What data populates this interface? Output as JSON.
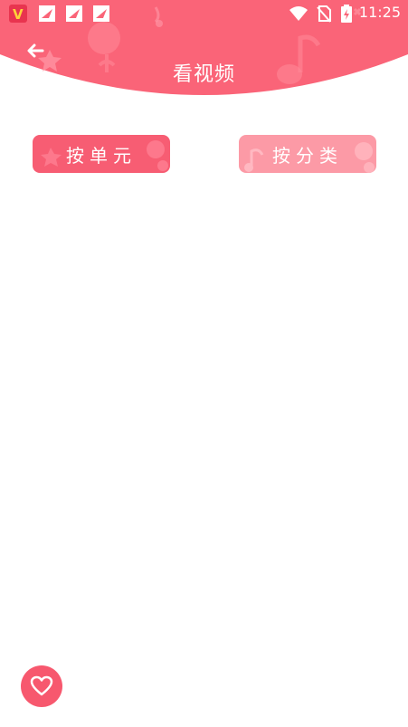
{
  "status_bar": {
    "time": "11:25",
    "notification_icons": [
      "vidmate-app-icon",
      "bird-app-icon",
      "bird-app-icon",
      "bird-app-icon"
    ],
    "system_icons": [
      "wifi-icon",
      "no-sim-icon",
      "battery-charging-icon"
    ]
  },
  "header": {
    "title": "看视频",
    "back_icon": "back-arrow-icon",
    "accent_color": "#fa6478"
  },
  "tabs": [
    {
      "label": "按单元",
      "color": "#f75d73",
      "selected": true
    },
    {
      "label": "按分类",
      "color": "#fc9aa6",
      "selected": false
    }
  ],
  "fab": {
    "icon": "heart-icon",
    "color": "#f7586e"
  }
}
